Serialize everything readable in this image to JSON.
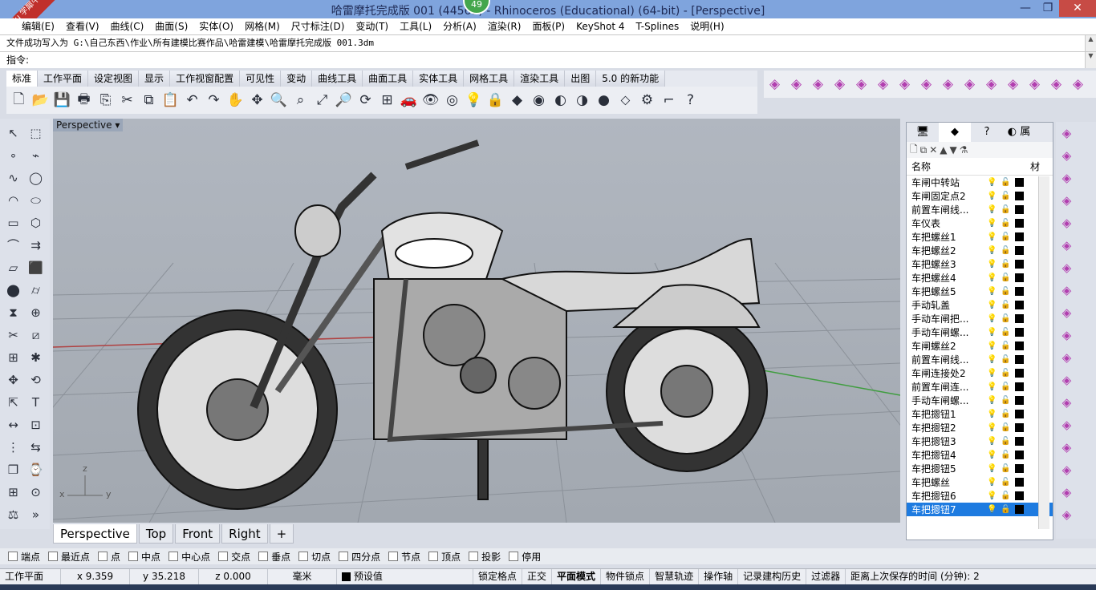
{
  "window": {
    "title": "哈雷摩托完成版 001 (44561) - Rhinoceros (Educational) (64-bit) - [Perspective]",
    "badge": "49",
    "watermark": "xuexiniu 学犀牛中文网"
  },
  "menu": [
    "编辑(E)",
    "查看(V)",
    "曲线(C)",
    "曲面(S)",
    "实体(O)",
    "网格(M)",
    "尺寸标注(D)",
    "变动(T)",
    "工具(L)",
    "分析(A)",
    "渲染(R)",
    "面板(P)",
    "KeyShot 4",
    "T-Splines",
    "说明(H)"
  ],
  "command": {
    "history": "文件成功写入为 G:\\自己东西\\作业\\所有建模比赛作品\\哈雷建模\\哈雷摩托完成版 001.3dm",
    "prompt": "指令:"
  },
  "toolbar_tabs": [
    "标准",
    "工作平面",
    "设定视图",
    "显示",
    "工作视窗配置",
    "可见性",
    "变动",
    "曲线工具",
    "曲面工具",
    "实体工具",
    "网格工具",
    "渲染工具",
    "出图",
    "5.0 的新功能"
  ],
  "viewport": {
    "name": "Perspective",
    "axes": {
      "x": "x",
      "y": "y",
      "z": "z"
    }
  },
  "viewport_tabs": [
    "Perspective",
    "Top",
    "Front",
    "Right",
    "+"
  ],
  "panel": {
    "tab4": "属",
    "col_name": "名称",
    "col_mat": "材",
    "layers": [
      "车闸中转站",
      "车闸固定点2",
      "前置车闸线...",
      "车仪表",
      "车把螺丝1",
      "车把螺丝2",
      "车把螺丝3",
      "车把螺丝4",
      "车把螺丝5",
      "手动轧盖",
      "手动车闸把...",
      "手动车闸螺...",
      "车闸螺丝2",
      "前置车闸线...",
      "车闸连接处2",
      "前置车闸连...",
      "手动车闸螺...",
      "车把摁钮1",
      "车把摁钮2",
      "车把摁钮3",
      "车把摁钮4",
      "车把摁钮5",
      "车把螺丝",
      "车把摁钮6",
      "车把摁钮7"
    ]
  },
  "osnap": [
    "端点",
    "最近点",
    "点",
    "中点",
    "中心点",
    "交点",
    "垂点",
    "切点",
    "四分点",
    "节点",
    "顶点",
    "投影",
    "停用"
  ],
  "status": {
    "cplane": "工作平面",
    "x": "x 9.359",
    "y": "y 35.218",
    "z": "z 0.000",
    "unit": "毫米",
    "layer": "预设值",
    "grid_snap": "锁定格点",
    "ortho": "正交",
    "planar": "平面模式",
    "osnap": "物件锁点",
    "smarttrack": "智慧轨迹",
    "gumball": "操作轴",
    "history": "记录建构历史",
    "filter": "过滤器",
    "autosave": "距离上次保存的时间 (分钟): 2"
  },
  "colors": {
    "selected": "#1e7be0",
    "title": "#7fa4dd"
  }
}
